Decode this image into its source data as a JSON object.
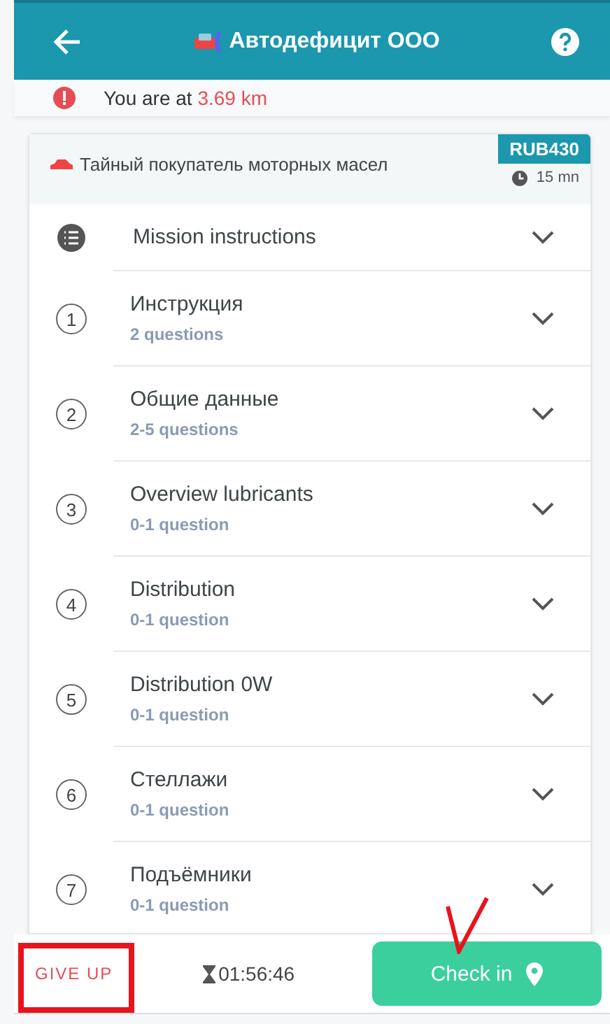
{
  "header": {
    "title": "Автодефицит ООО"
  },
  "distance": {
    "prefix": "You are at ",
    "value": "3.69 km"
  },
  "mission": {
    "title": "Тайный покупатель моторных масел",
    "reward": "RUB430",
    "duration": "15 mn"
  },
  "sections": [
    {
      "kind": "instructions",
      "title": "Mission instructions"
    },
    {
      "kind": "numbered",
      "number": "1",
      "title": "Инструкция",
      "subtitle": "2 questions"
    },
    {
      "kind": "numbered",
      "number": "2",
      "title": "Общие данные",
      "subtitle": "2-5 questions"
    },
    {
      "kind": "numbered",
      "number": "3",
      "title": "Overview lubricants",
      "subtitle": "0-1 question"
    },
    {
      "kind": "numbered",
      "number": "4",
      "title": "Distribution",
      "subtitle": "0-1 question"
    },
    {
      "kind": "numbered",
      "number": "5",
      "title": "Distribution 0W",
      "subtitle": "0-1 question"
    },
    {
      "kind": "numbered",
      "number": "6",
      "title": "Стеллажи",
      "subtitle": "0-1 question"
    },
    {
      "kind": "numbered",
      "number": "7",
      "title": "Подъёмники",
      "subtitle": "0-1 question"
    }
  ],
  "footer": {
    "give_up": "GIVE UP",
    "timer": "01:56:46",
    "check_in": "Check in"
  }
}
